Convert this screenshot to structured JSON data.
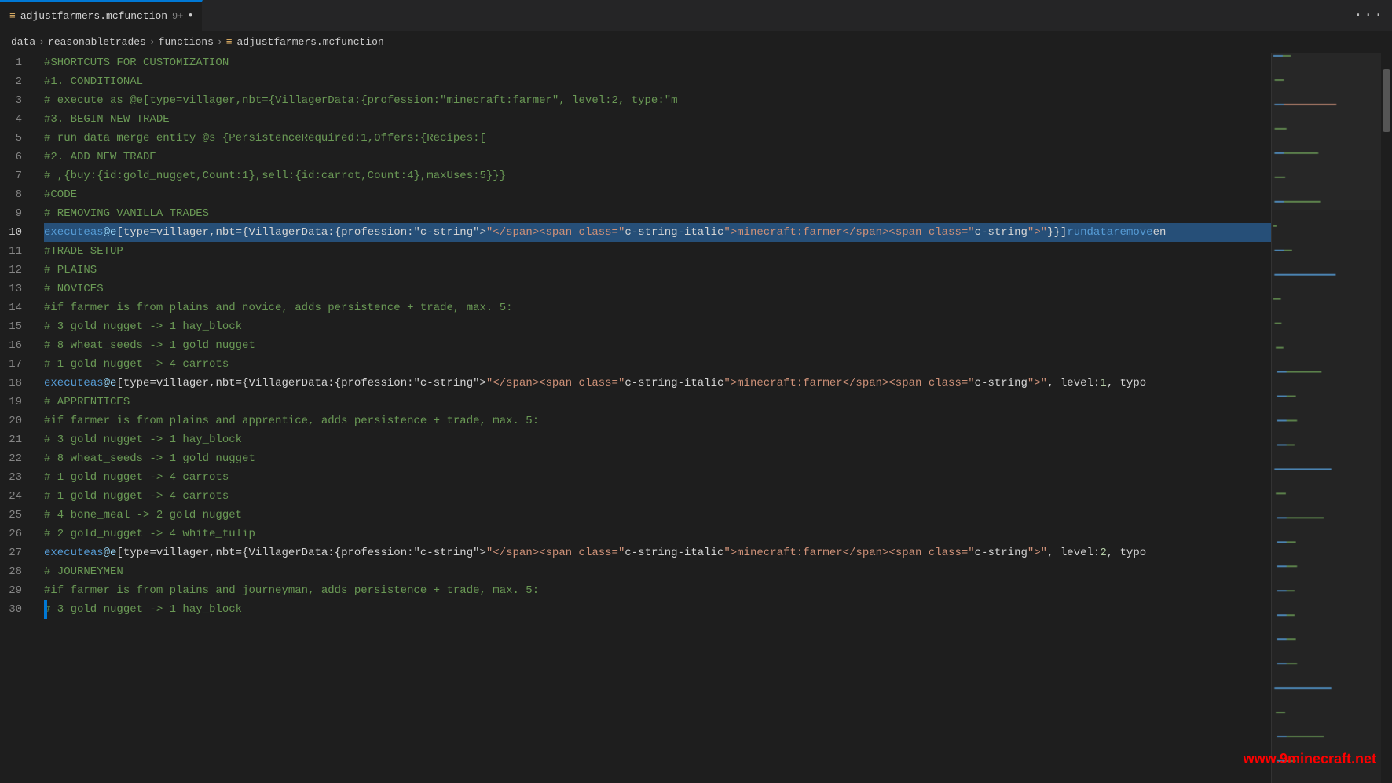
{
  "tab": {
    "icon": "≡",
    "label": "adjustfarmers.mcfunction",
    "modified_count": "9+",
    "dot": "●"
  },
  "breadcrumb": {
    "data": "data",
    "sep1": ">",
    "reasonabletrades": "reasonabletrades",
    "sep2": ">",
    "functions": "functions",
    "sep3": ">",
    "file_icon": "≡",
    "filename": "adjustfarmers.mcfunction"
  },
  "more_icon": "···",
  "lines": [
    {
      "num": 1,
      "content": "#SHORTCUTS FOR CUSTOMIZATION",
      "type": "comment"
    },
    {
      "num": 2,
      "content": "    #1. CONDITIONAL",
      "type": "comment"
    },
    {
      "num": 3,
      "content": "    #    execute as @e[type=villager,nbt={VillagerData:{profession:\"minecraft:farmer\", level:2, type:\"m",
      "type": "mixed"
    },
    {
      "num": 4,
      "content": "    #3. BEGIN NEW TRADE",
      "type": "comment"
    },
    {
      "num": 5,
      "content": "    #    run data merge entity @s {PersistenceRequired:1,Offers:{Recipes:[",
      "type": "comment"
    },
    {
      "num": 6,
      "content": "    #2. ADD NEW TRADE",
      "type": "comment"
    },
    {
      "num": 7,
      "content": "    #    ,{buy:{id:gold_nugget,Count:1},sell:{id:carrot,Count:4},maxUses:5}}}",
      "type": "comment"
    },
    {
      "num": 8,
      "content": "#CODE",
      "type": "comment"
    },
    {
      "num": 9,
      "content": "    #    REMOVING VANILLA TRADES",
      "type": "comment"
    },
    {
      "num": 10,
      "content": "    execute as @e[type=villager,nbt={VillagerData:{profession:\"minecraft:farmer\"}}] run data remove en",
      "type": "code"
    },
    {
      "num": 11,
      "content": "#TRADE SETUP",
      "type": "comment"
    },
    {
      "num": 12,
      "content": "    #    PLAINS",
      "type": "comment"
    },
    {
      "num": 13,
      "content": "        #    NOVICES",
      "type": "comment"
    },
    {
      "num": 14,
      "content": "            #if farmer is from plains and novice, adds persistence + trade, max. 5:",
      "type": "comment"
    },
    {
      "num": 15,
      "content": "            # 3 gold nugget -> 1 hay_block",
      "type": "comment"
    },
    {
      "num": 16,
      "content": "            # 8 wheat_seeds -> 1 gold nugget",
      "type": "comment"
    },
    {
      "num": 17,
      "content": "            # 1 gold nugget -> 4 carrots",
      "type": "comment"
    },
    {
      "num": 18,
      "content": "    execute as @e[type=villager,nbt={VillagerData:{profession:\"minecraft:farmer\", level:1, typo",
      "type": "code"
    },
    {
      "num": 19,
      "content": "        #    APPRENTICES",
      "type": "comment"
    },
    {
      "num": 20,
      "content": "            #if farmer is from plains and apprentice, adds persistence + trade, max. 5:",
      "type": "comment"
    },
    {
      "num": 21,
      "content": "            # 3 gold nugget -> 1 hay_block",
      "type": "comment"
    },
    {
      "num": 22,
      "content": "            # 8 wheat_seeds -> 1 gold nugget",
      "type": "comment"
    },
    {
      "num": 23,
      "content": "            # 1 gold nugget -> 4 carrots",
      "type": "comment"
    },
    {
      "num": 24,
      "content": "            # 1 gold nugget -> 4 carrots",
      "type": "comment"
    },
    {
      "num": 25,
      "content": "            # 4 bone_meal -> 2 gold nugget",
      "type": "comment"
    },
    {
      "num": 26,
      "content": "            # 2 gold_nugget -> 4 white_tulip",
      "type": "comment"
    },
    {
      "num": 27,
      "content": "    execute as @e[type=villager,nbt={VillagerData:{profession:\"minecraft:farmer\", level:2, typo",
      "type": "code"
    },
    {
      "num": 28,
      "content": "        #    JOURNEYMEN",
      "type": "comment"
    },
    {
      "num": 29,
      "content": "            #if farmer is from plains and journeyman, adds persistence + trade, max. 5:",
      "type": "comment"
    },
    {
      "num": 30,
      "content": "            # 3 gold nugget -> 1 hay_block",
      "type": "comment"
    }
  ],
  "watermark": "www.9minecraft.net"
}
